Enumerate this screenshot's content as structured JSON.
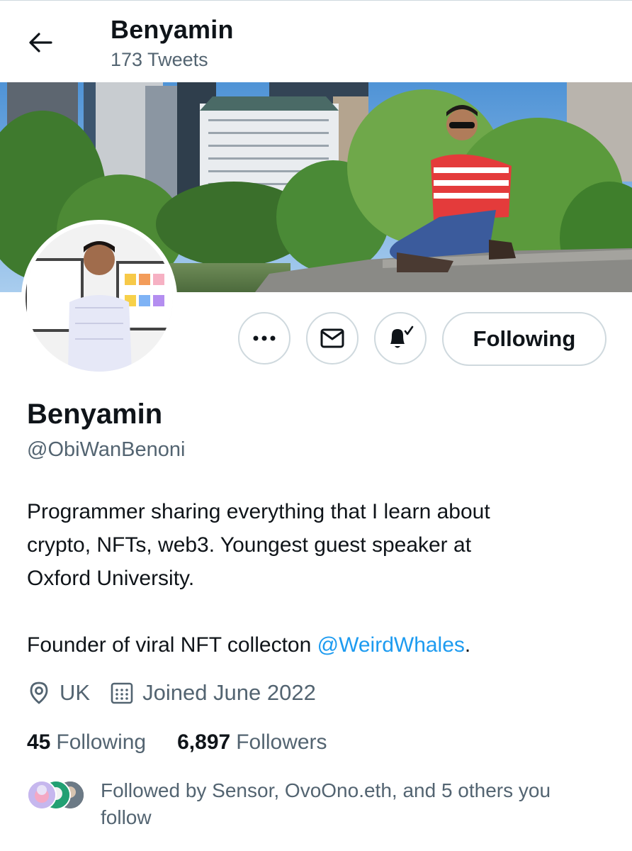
{
  "header": {
    "title": "Benyamin",
    "tweet_count": "173 Tweets"
  },
  "actions": {
    "follow_label": "Following"
  },
  "profile": {
    "name": "Benyamin",
    "handle": "@ObiWanBenoni",
    "bio_line1": "Programmer sharing everything that I learn about",
    "bio_line2": "crypto, NFTs, web3. Youngest guest speaker at",
    "bio_line3": "Oxford University.",
    "bio_line4_prefix": "Founder of viral NFT collecton ",
    "bio_mention": "@WeirdWhales",
    "bio_line4_suffix": ".",
    "location": "UK",
    "joined": "Joined June 2022"
  },
  "stats": {
    "following_count": "45",
    "following_label": "Following",
    "followers_count": "6,897",
    "followers_label": "Followers"
  },
  "followed_by": {
    "text_line1": "Followed by Sensor, OvoOno.eth, and 5 others you",
    "text_line2": "follow"
  },
  "colors": {
    "accent": "#1d9bf0",
    "text_primary": "#0f1419",
    "text_secondary": "#536471",
    "border": "#cfd9de"
  }
}
